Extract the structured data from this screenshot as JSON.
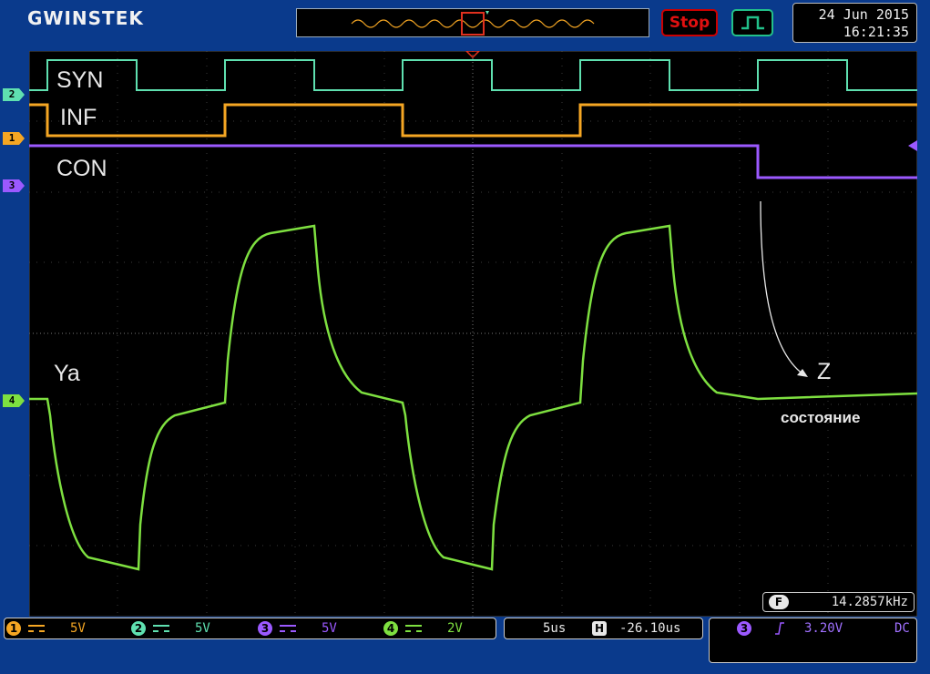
{
  "header": {
    "brand": "GWINSTEK",
    "run_button_label": "Stop",
    "trigger_mode_icon": "pulse-edge-icon",
    "date": "24 Jun 2015",
    "time": "16:21:35"
  },
  "channels_left": [
    {
      "id": "2",
      "color": "#5fe0b0"
    },
    {
      "id": "1",
      "color": "#f5a623"
    },
    {
      "id": "3",
      "color": "#9b59ff"
    },
    {
      "id": "4",
      "color": "#7ee040"
    }
  ],
  "waveforms": {
    "syn_label": "SYN",
    "inf_label": "INF",
    "con_label": "CON",
    "ya_label": "Ya",
    "z_label": "Z",
    "z_sublabel": "состояние"
  },
  "frequency": {
    "icon": "F",
    "value": "14.2857kHz"
  },
  "channel_bar": [
    {
      "num": "1",
      "scale": "5V",
      "color": "#f5a623"
    },
    {
      "num": "2",
      "scale": "5V",
      "color": "#5fe0b0"
    },
    {
      "num": "3",
      "scale": "5V",
      "color": "#9b59ff"
    },
    {
      "num": "4",
      "scale": "2V",
      "color": "#7ee040"
    }
  ],
  "timebase": {
    "scale": "5us",
    "h_icon": "H",
    "position": "-26.10us"
  },
  "trigger": {
    "source": "3",
    "slope_icon": "rising-edge-icon",
    "level": "3.20V",
    "coupling": "DC"
  },
  "colors": {
    "ch1": "#f5a623",
    "ch2": "#5fe0b0",
    "ch3": "#9b59ff",
    "ch4": "#7ee040",
    "background": "#0a3a8c",
    "screen": "#000000"
  }
}
